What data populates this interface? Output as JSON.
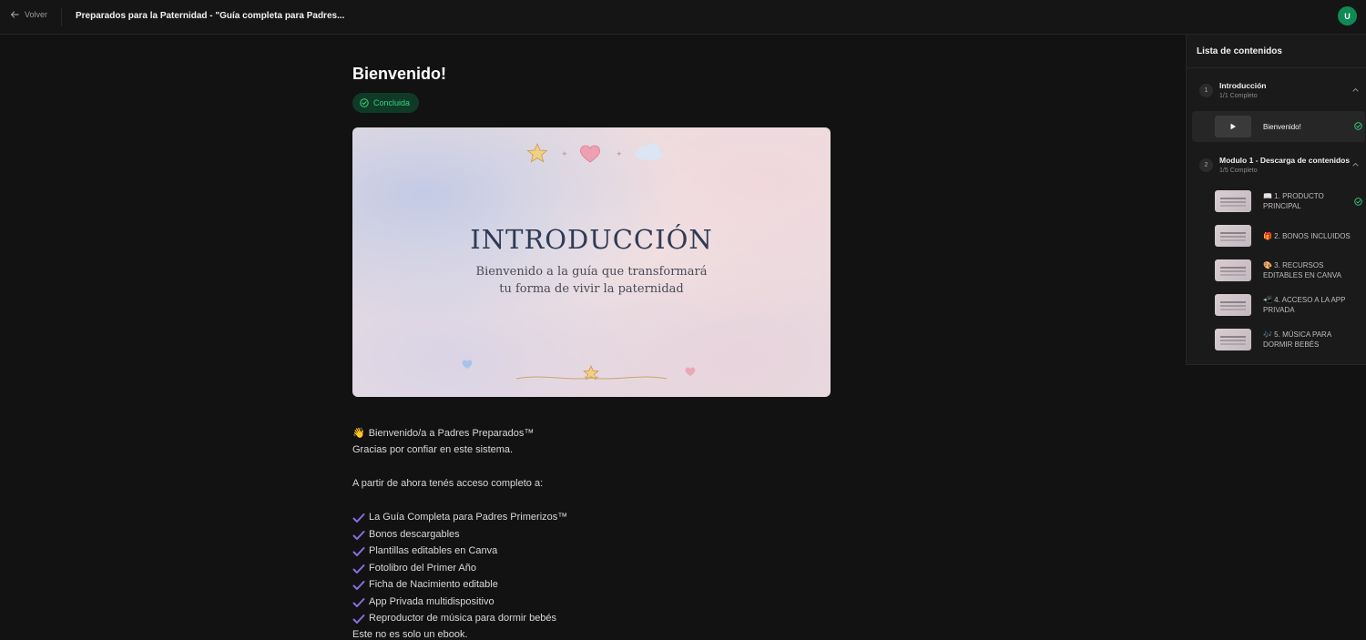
{
  "header": {
    "back_label": "Volver",
    "course_title": "Preparados para la Paternidad - \"Guía completa para Padres...",
    "avatar_initial": "U"
  },
  "lesson": {
    "title": "Bienvenido!",
    "status": "Concluida",
    "cover": {
      "title": "INTRODUCCIÓN",
      "subtitle_line1": "Bienvenido a la guía que transformará",
      "subtitle_line2": "tu forma de vivir la paternidad"
    },
    "intro_line1": "Bienvenido/a a Padres Preparados™",
    "intro_line1_icon": "👋",
    "intro_line2": "Gracias por confiar en este sistema.",
    "access_line": "A partir de ahora tenés acceso completo a:",
    "checklist": [
      "La Guía Completa para Padres Primerizos™",
      "Bonos descargables",
      "Plantillas editables en Canva",
      "Fotolibro del Primer Año",
      "Ficha de Nacimiento editable",
      "App Privada multidispositivo",
      "Reproductor de música para dormir bebés"
    ],
    "closing_line": "Este no es solo un ebook."
  },
  "sidebar": {
    "title": "Lista de contenidos",
    "modules": [
      {
        "number": "1",
        "name": "Introducción",
        "progress": "1/1 Completo",
        "lessons": [
          {
            "label": "Bienvenido!",
            "active": true,
            "completed": true
          }
        ]
      },
      {
        "number": "2",
        "name": "Modulo 1 - Descarga de contenidos",
        "progress": "1/5 Completo",
        "lessons": [
          {
            "label": "📖 1. PRODUCTO PRINCIPAL",
            "completed": true
          },
          {
            "label": "🎁 2. BONOS INCLUIDOS",
            "completed": false
          },
          {
            "label": "🎨 3. RECURSOS EDITABLES EN CANVA",
            "completed": false
          },
          {
            "label": "📲 4. ACCESO A LA APP PRIVADA",
            "completed": false
          },
          {
            "label": "🎶 5. MÚSICA PARA DORMIR BEBÉS",
            "completed": false
          }
        ]
      }
    ]
  },
  "colors": {
    "background": "#121212",
    "accent_green": "#3bd17f",
    "check_purple": "#8b6fe0",
    "avatar": "#0f8a55"
  }
}
